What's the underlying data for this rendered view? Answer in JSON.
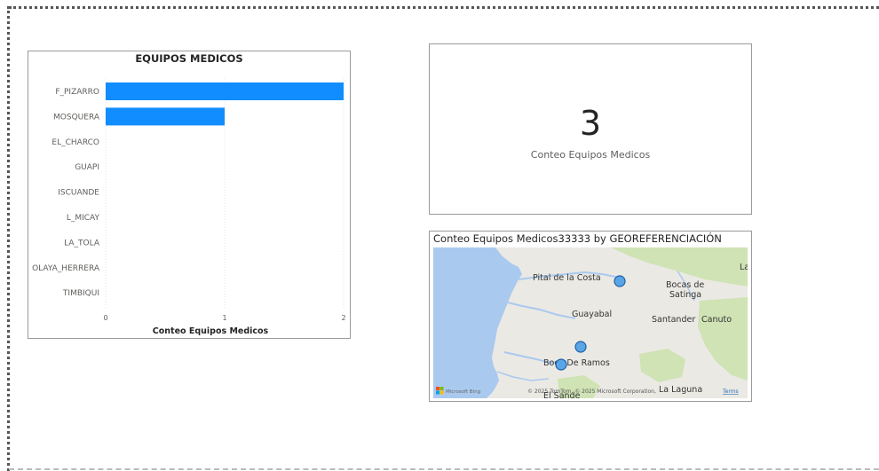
{
  "chart_data": [
    {
      "type": "bar",
      "title": "EQUIPOS MEDICOS",
      "orientation": "horizontal",
      "categories": [
        "F_PIZARRO",
        "MOSQUERA",
        "EL_CHARCO",
        "GUAPI",
        "ISCUANDE",
        "L_MICAY",
        "LA_TOLA",
        "OLAYA_HERRERA",
        "TIMBIQUI"
      ],
      "values": [
        2,
        1,
        0,
        0,
        0,
        0,
        0,
        0,
        0
      ],
      "xlabel": "Conteo Equipos Medicos",
      "ylabel": "",
      "xlim": [
        0,
        2
      ],
      "xticks": [
        "0",
        "1",
        "2"
      ],
      "bar_color": "#118dff",
      "grid": true
    }
  ],
  "card": {
    "value": "3",
    "label": "Conteo Equipos Medicos"
  },
  "map": {
    "title": "Conteo Equipos Medicos33333 by GEOREFERENCIACIÓN",
    "places": {
      "pital": "Pital de la Costa",
      "bocas1": "Bocas de",
      "bocas2": "Satinga",
      "guayabal": "Guayabal",
      "santander": "Santander",
      "canuto": "Canuto",
      "boca_ramos": "Boca De Ramos",
      "la_laguna": "La Laguna",
      "el_sande": "El Sande",
      "la": "La"
    },
    "attribution": "© 2025 TomTom, © 2025 Microsoft Corporation,",
    "terms": "Terms",
    "bing": "Microsoft Bing",
    "colors": {
      "water": "#aac9ef",
      "land": "#ebe9e4",
      "forest": "#cfe3b5",
      "bubble": "#5aa5e6"
    }
  }
}
